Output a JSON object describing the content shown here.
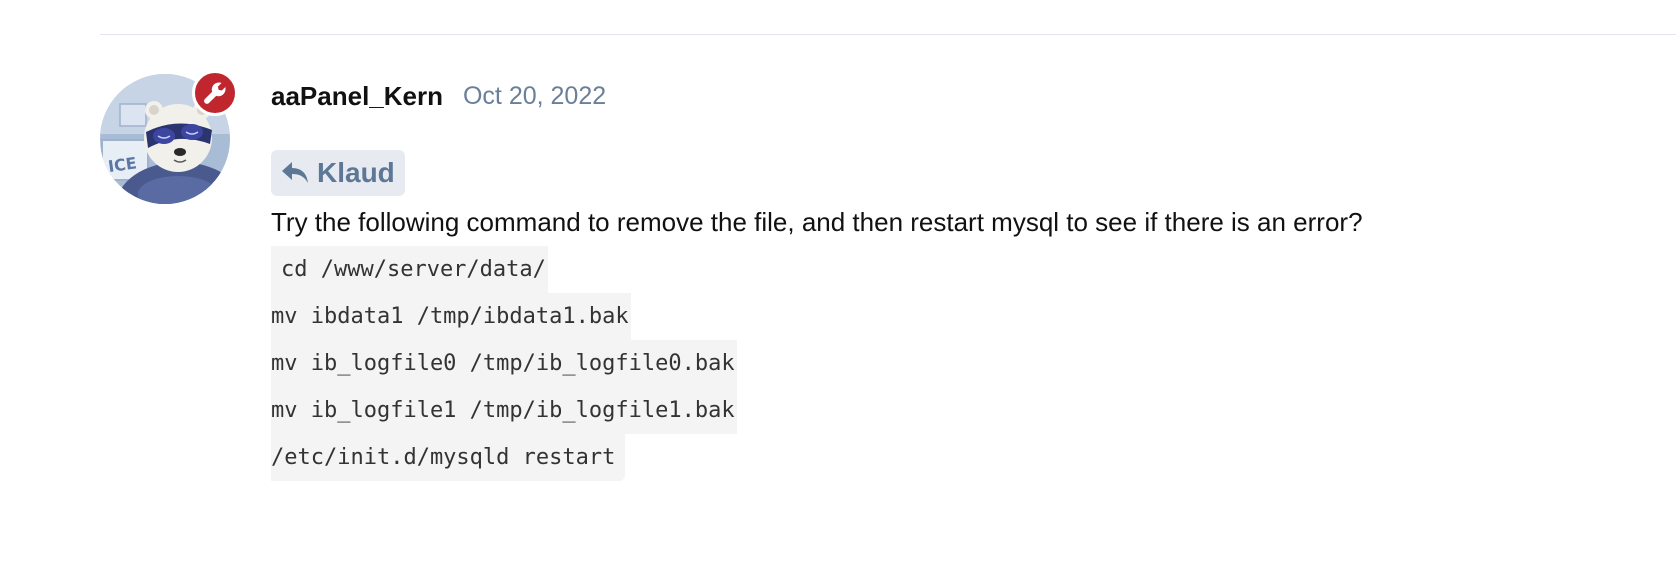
{
  "post": {
    "author": {
      "username": "aaPanel_Kern",
      "avatar_icon": "polar-bear-avatar",
      "badge_icon": "wrench-icon",
      "badge_color": "#c0262d"
    },
    "date": "Oct 20, 2022",
    "reply_to": {
      "icon": "reply-arrow-icon",
      "name": "Klaud"
    },
    "body_text": "Try the following command to remove the file, and then restart mysql to see if there is an error?",
    "code_lines": [
      "cd /www/server/data/",
      "mv ibdata1 /tmp/ibdata1.bak",
      "mv ib_logfile0 /tmp/ib_logfile0.bak",
      "mv ib_logfile1 /tmp/ib_logfile1.bak",
      "/etc/init.d/mysqld restart"
    ]
  },
  "colors": {
    "date": "#6a7f99",
    "reply_bg": "#e7ebf1",
    "reply_text": "#5d7896",
    "code_bg": "#f4f4f4",
    "divider": "#e4e6f2"
  }
}
